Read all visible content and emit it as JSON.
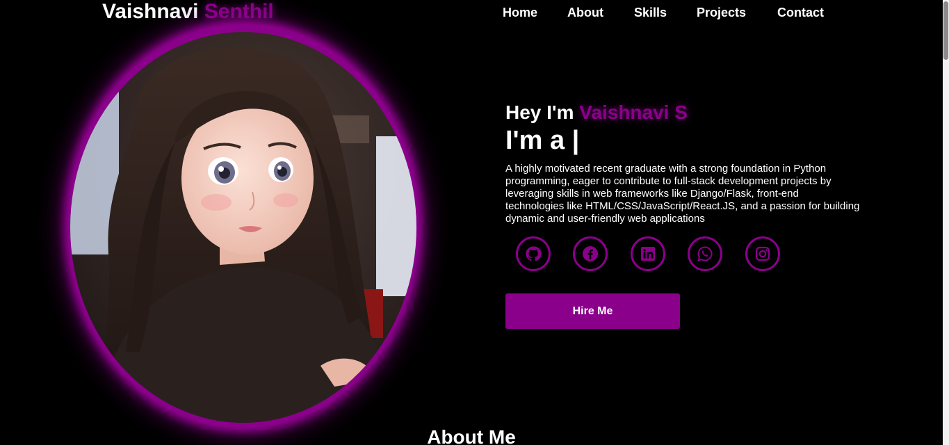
{
  "header": {
    "logo_first": "Vaishnavi",
    "logo_last": "Senthil",
    "nav": [
      {
        "label": "Home"
      },
      {
        "label": "About"
      },
      {
        "label": "Skills"
      },
      {
        "label": "Projects"
      },
      {
        "label": "Contact"
      }
    ]
  },
  "hero": {
    "greeting": "Hey I'm",
    "name": "Vaishnavi S",
    "typing": "I'm a |",
    "bio": "A highly motivated recent graduate with a strong foundation in Python programming, eager to contribute to full-stack development projects by leveraging skills in web frameworks like Django/Flask, front-end technologies like HTML/CSS/JavaScript/React.JS, and a passion for building dynamic and user-friendly web applications",
    "socials": [
      {
        "icon": "github-icon"
      },
      {
        "icon": "facebook-icon"
      },
      {
        "icon": "linkedin-icon"
      },
      {
        "icon": "whatsapp-icon"
      },
      {
        "icon": "instagram-icon"
      }
    ],
    "hire_label": "Hire Me"
  },
  "about": {
    "heading": "About Me"
  },
  "colors": {
    "background": "#000000",
    "accent": "#8b008b",
    "text": "#ffffff"
  }
}
